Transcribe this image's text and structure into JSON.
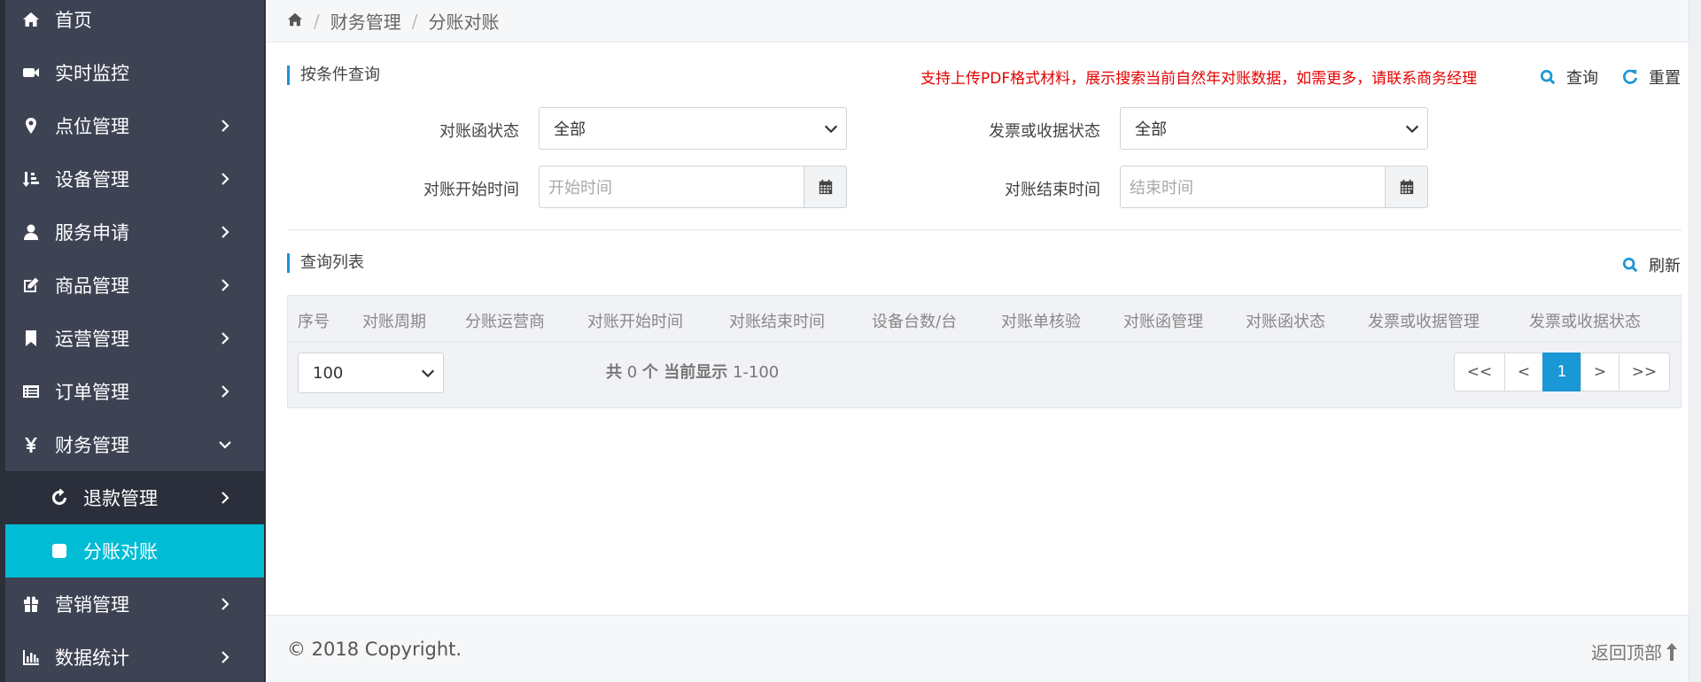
{
  "sidebar": {
    "items": [
      {
        "label": "首页",
        "icon": "home-icon"
      },
      {
        "label": "实时监控",
        "icon": "video-camera-icon"
      },
      {
        "label": "点位管理",
        "icon": "map-pin-icon"
      },
      {
        "label": "设备管理",
        "icon": "sort-icon"
      },
      {
        "label": "服务申请",
        "icon": "user-icon"
      },
      {
        "label": "商品管理",
        "icon": "edit-icon"
      },
      {
        "label": "运营管理",
        "icon": "bookmark-icon"
      },
      {
        "label": "订单管理",
        "icon": "list-card-icon"
      },
      {
        "label": "财务管理",
        "icon": "yen-icon"
      },
      {
        "label": "退款管理",
        "icon": "refresh-icon"
      },
      {
        "label": "分账对账",
        "icon": "square-icon"
      },
      {
        "label": "营销管理",
        "icon": "gift-icon"
      },
      {
        "label": "数据统计",
        "icon": "bar-chart-icon"
      }
    ]
  },
  "breadcrumb": {
    "items": [
      "财务管理",
      "分账对账"
    ]
  },
  "query": {
    "title": "按条件查询",
    "notice": "支持上传PDF格式材料，展示搜索当前自然年对账数据，如需更多，请联系商务经理",
    "search_label": "查询",
    "reset_label": "重置",
    "status_label": "对账函状态",
    "status_value": "全部",
    "invoice_label": "发票或收据状态",
    "invoice_value": "全部",
    "start_label": "对账开始时间",
    "start_placeholder": "开始时间",
    "end_label": "对账结束时间",
    "end_placeholder": "结束时间"
  },
  "list": {
    "title": "查询列表",
    "refresh_label": "刷新",
    "columns": [
      "序号",
      "对账周期",
      "分账运营商",
      "对账开始时间",
      "对账结束时间",
      "设备台数/台",
      "对账单核验",
      "对账函管理",
      "对账函状态",
      "发票或收据管理",
      "发票或收据状态"
    ],
    "page_size": "100",
    "info_total_prefix": "共",
    "info_total": "0",
    "info_total_suffix": "个 当前显示",
    "info_range": "1-100",
    "pager": [
      "<<",
      "<",
      "1",
      ">",
      ">>"
    ]
  },
  "footer": {
    "copyright": "© 2018 Copyright.",
    "back_to_top": "返回顶部"
  },
  "colors": {
    "sidebar_bg": "#3e4354",
    "active": "#00bcd4",
    "accent": "#1a97d5",
    "notice": "#e60000"
  }
}
